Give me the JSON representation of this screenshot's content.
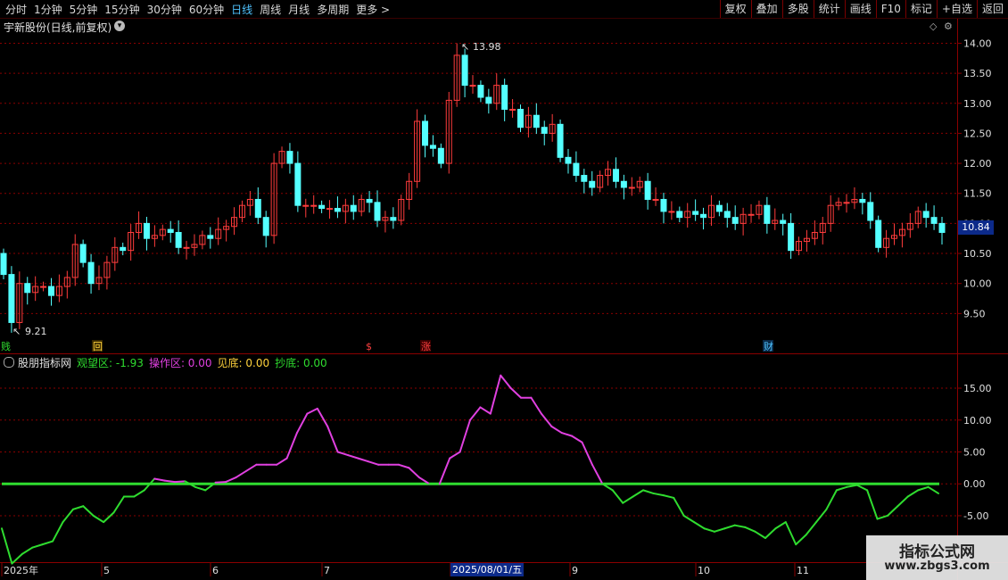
{
  "toolbar": {
    "periods": [
      "分时",
      "1分钟",
      "5分钟",
      "15分钟",
      "30分钟",
      "60分钟",
      "日线",
      "周线",
      "月线",
      "多周期",
      "更多 >"
    ],
    "active_period": "日线",
    "actions": [
      "复权",
      "叠加",
      "多股",
      "统计",
      "画线",
      "F10",
      "标记",
      "+自选",
      "返回"
    ]
  },
  "stock": {
    "title": "宇新股份(日线,前复权)",
    "last_price": "10.84"
  },
  "markers": {
    "high": {
      "label": "13.98",
      "value": 13.98
    },
    "low": {
      "label": "9.21",
      "value": 9.21
    },
    "events": [
      "贱",
      "回",
      "$",
      "涨",
      "财"
    ]
  },
  "price_axis": {
    "ticks": [
      "14.00",
      "13.50",
      "13.00",
      "12.50",
      "12.00",
      "11.50",
      "11.00",
      "10.50",
      "10.00",
      "9.50"
    ],
    "min": 9.0,
    "max": 14.2
  },
  "indicator": {
    "name": "股朋指标网",
    "items": [
      {
        "label": "观望区: -1.93",
        "color": "#2fdc2f"
      },
      {
        "label": "操作区: 0.00",
        "color": "#e040e0"
      },
      {
        "label": "见底: 0.00",
        "color": "#ffd23c"
      },
      {
        "label": "抄底: 0.00",
        "color": "#2fdc2f"
      }
    ],
    "ticks": [
      "15.00",
      "10.00",
      "5.00",
      "0.00",
      "-5.00"
    ],
    "min": -12,
    "max": 18.5
  },
  "date_axis": {
    "labels": [
      "2025年",
      "5",
      "6",
      "7",
      "2025/08/01/五",
      "9",
      "10",
      "11"
    ],
    "cursor_label": "2025/08/01/五"
  },
  "colors": {
    "up": "#ff3c3c",
    "down": "#54ffff",
    "grid": "#8a0000",
    "operate": "#e040e0",
    "watch": "#2fdc2f"
  },
  "watermark": {
    "line1": "指标公式网",
    "line2": "www.zbgs3.com"
  },
  "chart_data": {
    "type": "candlestick",
    "closes": [
      10.15,
      9.35,
      10.0,
      9.85,
      9.95,
      9.95,
      9.8,
      9.95,
      10.1,
      10.65,
      10.35,
      10.0,
      10.1,
      10.35,
      10.6,
      10.55,
      10.85,
      11.0,
      10.75,
      10.8,
      10.9,
      10.85,
      10.6,
      10.6,
      10.65,
      10.8,
      10.75,
      10.9,
      10.95,
      11.1,
      11.3,
      11.4,
      11.1,
      10.8,
      12.0,
      12.2,
      12.0,
      11.3,
      11.3,
      11.3,
      11.25,
      11.25,
      11.2,
      11.3,
      11.2,
      11.4,
      11.35,
      11.05,
      11.1,
      11.05,
      11.4,
      11.7,
      12.7,
      12.3,
      12.25,
      12.0,
      13.05,
      13.8,
      13.3,
      13.3,
      13.1,
      13.0,
      13.3,
      12.9,
      12.9,
      12.6,
      12.8,
      12.6,
      12.5,
      12.65,
      12.1,
      12.0,
      11.8,
      11.7,
      11.6,
      11.8,
      11.9,
      11.7,
      11.6,
      11.6,
      11.7,
      11.4,
      11.4,
      11.2,
      11.2,
      11.1,
      11.2,
      11.15,
      11.1,
      11.3,
      11.2,
      11.1,
      11.0,
      11.15,
      11.15,
      11.3,
      11.0,
      11.05,
      11.0,
      10.55,
      10.7,
      10.75,
      10.85,
      11.0,
      11.3,
      11.35,
      11.35,
      11.4,
      11.35,
      11.05,
      10.6,
      10.75,
      10.8,
      10.9,
      11.0,
      11.2,
      11.1,
      11.0,
      10.85
    ],
    "watch_zone_series": [
      -7,
      -12.5,
      -11,
      -10,
      -9.5,
      -9,
      -6,
      -4,
      -3.5,
      -5,
      -6,
      -4.5,
      -2,
      -2,
      -1,
      0.8,
      0.5,
      0.3,
      0.4,
      -0.5,
      -1,
      0.2,
      0.3,
      1,
      2,
      3,
      3,
      3,
      4,
      8,
      11,
      11.8,
      9,
      5,
      4.5,
      4,
      3.5,
      3,
      3,
      3,
      2.5,
      1,
      0,
      0,
      4,
      5,
      10,
      12,
      11,
      17,
      15,
      13.5,
      13.5,
      11,
      9,
      8,
      7.5,
      6.5,
      3,
      0,
      -1,
      -3,
      -2,
      -1,
      -1.5,
      -1.8,
      -2.2,
      -5,
      -6,
      -7,
      -7.5,
      -7,
      -6.5,
      -6.8,
      -7.5,
      -8.5,
      -7,
      -6,
      -9.5,
      -8,
      -6,
      -4,
      -1,
      -0.5,
      -0.2,
      -1,
      -5.5,
      -5,
      -3.5,
      -2,
      -1,
      -0.5,
      -1.5
    ],
    "baseline": 0
  }
}
